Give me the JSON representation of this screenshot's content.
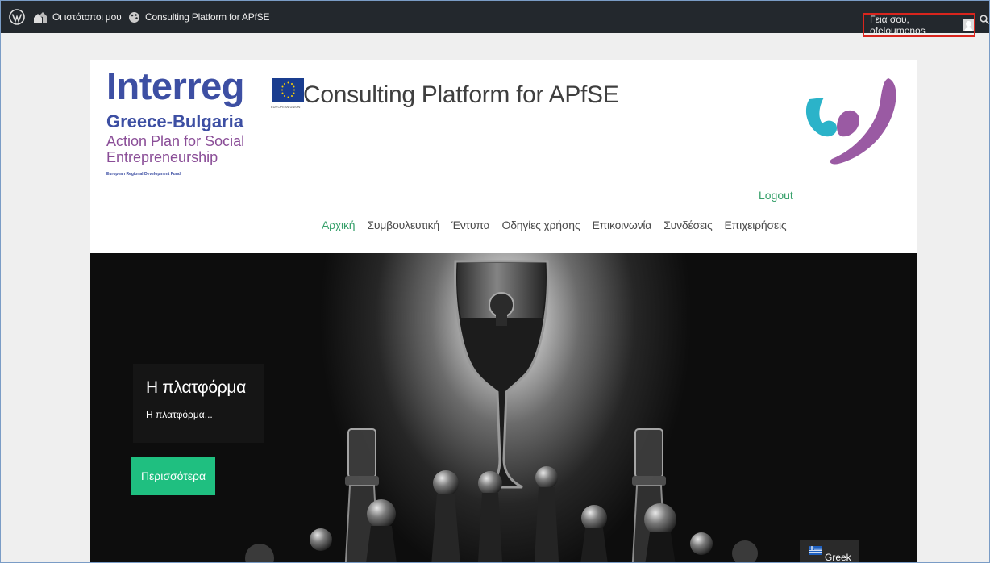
{
  "admin_bar": {
    "wp_icon": "wordpress-icon",
    "my_sites": {
      "icon": "house-icon",
      "label": "Οι ιστότοποι μου"
    },
    "site": {
      "icon": "palette-icon",
      "label": "Consulting Platform for APfSE"
    },
    "account": {
      "greeting": "Γεια σου, ofeloumenos",
      "avatar": "avatar-placeholder"
    },
    "search_icon": "search-icon",
    "colors": {
      "background": "#23282d",
      "highlight_border": "#d9251d"
    }
  },
  "header": {
    "logo": {
      "interreg": "Interreg",
      "region": "Greece-Bulgaria",
      "program_line1": "Action Plan for Social",
      "program_line2": "Entrepreneurship",
      "fund": "European Regional Development Fund",
      "eu_label": "EUROPEAN UNION"
    },
    "site_title": "Consulting Platform for APfSE",
    "logout": "Logout",
    "colors": {
      "brand_blue": "#3d4fa3",
      "brand_purple": "#8a4d97",
      "accent_green": "#36a06a"
    }
  },
  "nav": {
    "items": [
      {
        "label": "Αρχική",
        "active": true
      },
      {
        "label": "Συμβουλευτική",
        "active": false
      },
      {
        "label": "Έντυπα",
        "active": false
      },
      {
        "label": "Οδηγίες χρήσης",
        "active": false
      },
      {
        "label": "Επικοινωνία",
        "active": false
      },
      {
        "label": "Συνδέσεις",
        "active": false
      },
      {
        "label": "Επιχειρήσεις",
        "active": false
      }
    ]
  },
  "hero": {
    "slide_title": "Η πλατφόρμα",
    "slide_text": "Η πλατφόρμα...",
    "button": "Περισσότερα",
    "language": {
      "icon": "greek-flag-icon",
      "label": "Greek"
    },
    "colors": {
      "button": "#1fbf80"
    }
  }
}
